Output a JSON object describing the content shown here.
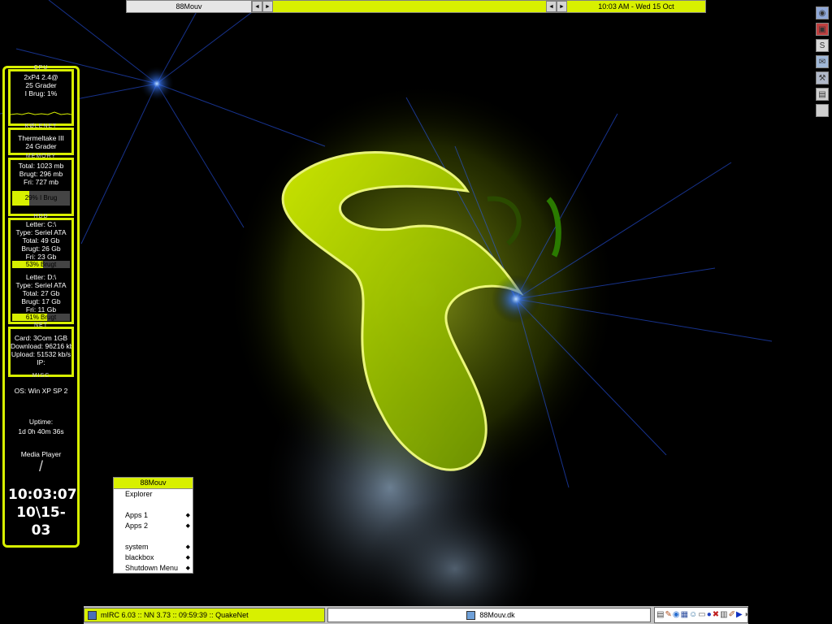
{
  "toolbar": {
    "workspace": "88Mouv",
    "clock": "10:03 AM - Wed 15 Oct",
    "prev_glyph": "◄",
    "next_glyph": "►"
  },
  "slit": {
    "icons": [
      "globe-icon",
      "media-icon",
      "messenger-icon",
      "network-icon",
      "tools-icon",
      "chip-icon",
      "blank-icon"
    ]
  },
  "monitor": {
    "cpu": {
      "title": "CPU",
      "model": "2xP4 2.4@",
      "temp": "25 Grader",
      "usage": "I Brug: 1%"
    },
    "cooler": {
      "title": "KØLENET",
      "model": "Thermeltake III",
      "temp": "24 Grader"
    },
    "memory": {
      "title": "MEMORY",
      "total": "Total: 1023 mb",
      "used": "Brugt: 296 mb",
      "free": "Fri: 727 mb",
      "bar_label": "29% I Brug",
      "bar_fraction": 0.29
    },
    "hdd": {
      "title": "HDD",
      "c": {
        "letter": "Letter: C:\\",
        "type": "Type: Seriel ATA",
        "total": "Total: 49 Gb",
        "used": "Brugt: 26 Gb",
        "free": "Fri: 23 Gb",
        "bar_label": "53% Brugt",
        "bar_fraction": 0.53
      },
      "d": {
        "letter": "Letter: D:\\",
        "type": "Type: Seriel ATA",
        "total": "Total: 27 Gb",
        "used": "Brugt: 17 Gb",
        "free": "Fri: 11 Gb",
        "bar_label": "61% Brugt",
        "bar_fraction": 0.61
      }
    },
    "net": {
      "title": "NET",
      "card": "Card: 3Com 1GB",
      "download": "Download: 96216 kb/",
      "upload": "Upload: 51532 kb/s",
      "ip": "IP:"
    },
    "misc": {
      "title": "MISC",
      "os": "OS: Win XP SP 2",
      "uptime_label": "Uptime:",
      "uptime": "1d 0h 40m 36s",
      "media_player": "Media Player",
      "media_glyph": "/",
      "time": "10:03:07",
      "date": "10\\15-03"
    }
  },
  "menu": {
    "title": "88Mouv",
    "explorer": "Explorer",
    "apps1": "Apps 1",
    "apps2": "Apps 2",
    "system": "system",
    "blackbox": "blackbox",
    "shutdown": "Shutdown Menu",
    "arrow": "◆"
  },
  "taskbar": {
    "task1": "mIRC 6.03 :: NN 3.73 :: 09:59:39 :: QuakeNet",
    "task2": "88Mouv.dk",
    "tray_icons": [
      "chip-icon",
      "app-icon",
      "globe-icon",
      "grid-icon",
      "user-icon",
      "printer-icon",
      "play-icon",
      "clipboard-icon",
      "tools-icon",
      "chart-icon",
      "media-icon",
      "speaker-icon"
    ]
  },
  "colors": {
    "accent": "#d8f000",
    "background": "#000000"
  }
}
